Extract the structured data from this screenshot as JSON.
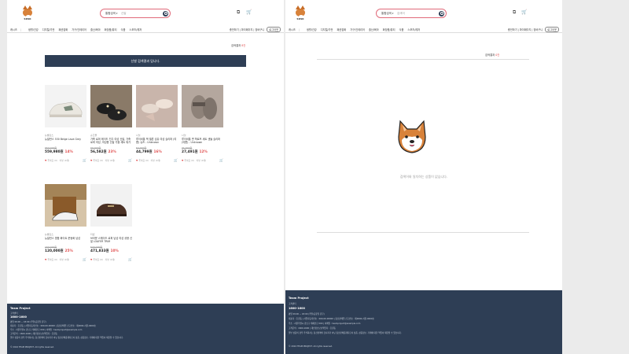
{
  "header": {
    "logo_text": "SDSK",
    "search_type": "통합검색",
    "left_search_value": "신발",
    "right_search_placeholder": "검색어"
  },
  "nav": {
    "categories": [
      "캐시즈",
      "생활/건강",
      "디지털/가전",
      "패션잡화",
      "가구/인테리어",
      "출산/육아",
      "화장품/뷰티",
      "식품",
      "스포츠/레저"
    ],
    "user": [
      "충전하기",
      "마이페이지",
      "장바구니"
    ],
    "logout": "로그아웃"
  },
  "left": {
    "count_label": "검색결과 ",
    "count_num": "8건",
    "banner": "신발 검색결과 입니다.",
    "products": [
      {
        "brand": "뉴발란스",
        "title": "뉴발란스 530 Beige Lava Grey",
        "orig": "650,000원",
        "price": "559,980원",
        "disc": "14%",
        "likes": "0",
        "reviews": "0"
      },
      {
        "brand": "슈즈몰",
        "title": "가죽 로퍼 메이드 진주 여성 신발, 가죽 로퍼 여성, 여성용 신발 가을 세트 특가",
        "orig": "69,000원",
        "price": "56,582원",
        "disc": "23%",
        "likes": "0",
        "reviews": "0"
      },
      {
        "brand": "나잇",
        "title": "루이비통 백 엘른 섬유 여성 슬리퍼 (여름) 슈즈 - Unknown",
        "orig": "52,000원",
        "price": "44,799원",
        "disc": "16%",
        "likes": "0",
        "reviews": "0"
      },
      {
        "brand": "나잇",
        "title": "루이비통 면 혁로프 세트 샌들 슬리퍼 (여름) - Unknown",
        "orig": "31,000원",
        "price": "27,491원",
        "disc": "12%",
        "likes": "0",
        "reviews": "0"
      },
      {
        "brand": "뉴발란스",
        "title": "뉴발란스 명품 화이트 운동화 남성",
        "orig": "160,000원",
        "price": "120,000원",
        "disc": "25%",
        "likes": "0",
        "reviews": "0"
      },
      {
        "brand": "더샵",
        "title": "브라운 스웨이드 로퍼 남성 여성 공용 신발 LOAFER TRIM",
        "orig": "540,000원",
        "price": "471,833원",
        "disc": "10%",
        "likes": "0",
        "reviews": "0"
      }
    ],
    "like_label": "좋아요 ",
    "review_label": "리뷰 ",
    "review_unit": "개"
  },
  "right": {
    "count_label": "검색결과 ",
    "count_num": "0건",
    "empty_text": "검색어와 일치하는 상품이 없습니다."
  },
  "footer": {
    "title": "Team Project",
    "sub": "고객센터",
    "phone": "1600-1600",
    "hours": "평일 09:00 ~ 18:00 (주말/공휴일 휴무)",
    "lines": [
      "대표자 : 홍길동  |  사업자등록번호 : 000-00-00000  |  통신판매업 신고번호 : 제0000-서울-0000호",
      "주소 : 서울특별시 강남구 테헤란로 000  |  이메일 : teamproject@example.com",
      "고객문의 : 1600-1600  |  개인정보보호책임자 : 홍길동",
      "일부 상품의 경우 주식회사는 통신판매의 당사자가 아닌 통신판매중개자로서 상품, 상품정보, 거래에 대한 책임이 제한될 수 있습니다."
    ],
    "copyright": "© 2024 TEAM PROJECT. All rights reserved."
  },
  "colors": {
    "navy": "#2e3e55",
    "accent": "#e05050",
    "search_border": "#e06a7a"
  }
}
